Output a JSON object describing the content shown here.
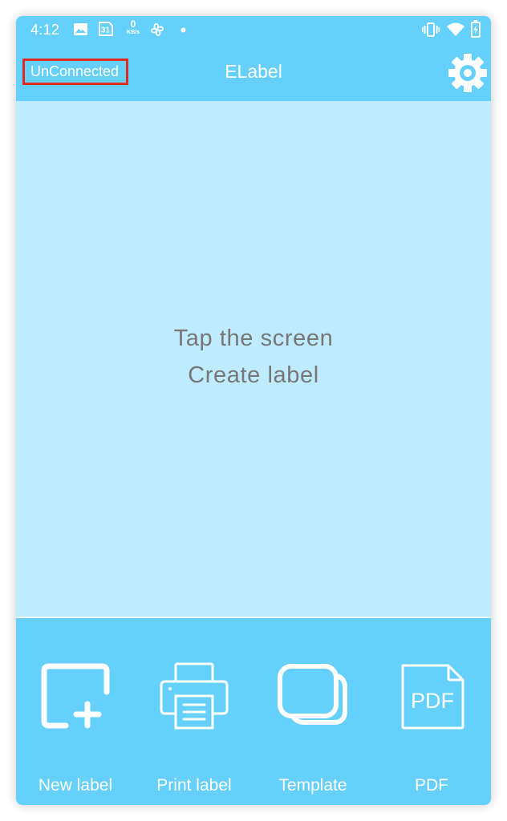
{
  "status_bar": {
    "time": "4:12",
    "left_icons": [
      "image-icon",
      "calendar-icon",
      "network-speed-icon",
      "fan-icon",
      "dot-icon"
    ],
    "calendar_day": "31",
    "net_speed_value": "0",
    "net_speed_unit": "KB/s",
    "right_icons": [
      "vibrate-icon",
      "wifi-icon",
      "battery-charging-icon"
    ]
  },
  "app_bar": {
    "connection_status": "UnConnected",
    "title": "ELabel",
    "settings_icon": "gear-icon"
  },
  "canvas": {
    "hint_line1": "Tap the screen",
    "hint_line2": "Create label"
  },
  "toolbar": {
    "items": [
      {
        "label": "New label",
        "icon": "new-label-icon"
      },
      {
        "label": "Print label",
        "icon": "printer-icon"
      },
      {
        "label": "Template",
        "icon": "template-icon"
      },
      {
        "label": "PDF",
        "icon": "pdf-icon",
        "icon_text": "PDF"
      }
    ]
  },
  "colors": {
    "bar": "#66d0fd",
    "canvas": "#bfebff",
    "hint_text": "#777777",
    "highlight_border": "#e02a1f"
  }
}
